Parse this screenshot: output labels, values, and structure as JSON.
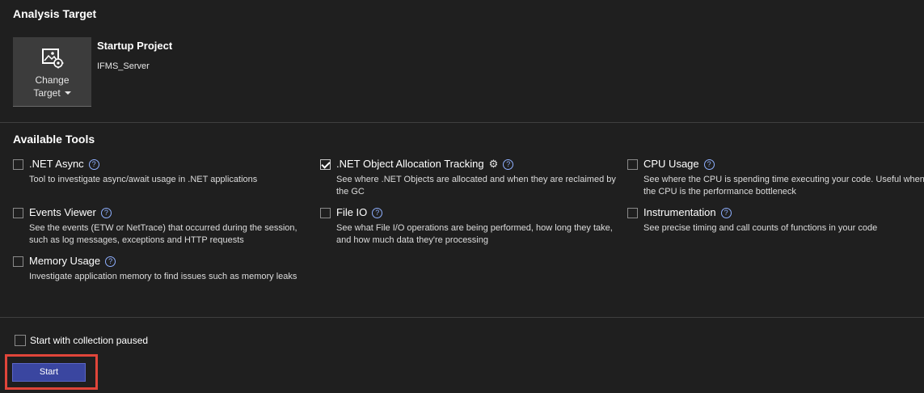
{
  "analysis_target": {
    "title": "Analysis Target",
    "change_target": {
      "line1": "Change",
      "line2": "Target",
      "icon": "target-image-gear-icon"
    },
    "startup_project_label": "Startup Project",
    "startup_project_value": "IFMS_Server"
  },
  "available_tools": {
    "title": "Available Tools",
    "tools": [
      {
        "name": ".NET Async",
        "checked": false,
        "description": "Tool to investigate async/await usage in .NET applications"
      },
      {
        "name": ".NET Object Allocation Tracking",
        "checked": true,
        "has_settings": true,
        "description": "See where .NET Objects are allocated and when they are reclaimed by the GC"
      },
      {
        "name": "CPU Usage",
        "checked": false,
        "description": "See where the CPU is spending time executing your code. Useful when the CPU is the performance bottleneck"
      },
      {
        "name": "Events Viewer",
        "checked": false,
        "description": "See the events (ETW or NetTrace) that occurred during the session, such as log messages, exceptions and HTTP requests"
      },
      {
        "name": "File IO",
        "checked": false,
        "description": "See what File I/O operations are being performed, how long they take, and how much data they're processing"
      },
      {
        "name": "Instrumentation",
        "checked": false,
        "description": "See precise timing and call counts of functions in your code"
      },
      {
        "name": "Memory Usage",
        "checked": false,
        "description": "Investigate application memory to find issues such as memory leaks"
      }
    ]
  },
  "collection_paused": {
    "label": "Start with collection paused",
    "checked": false
  },
  "start_button": {
    "label": "Start"
  },
  "colors": {
    "background": "#1f1f1f",
    "start_button": "#3a46a0",
    "highlight": "#e0453a",
    "help_icon": "#8fb0ff"
  }
}
